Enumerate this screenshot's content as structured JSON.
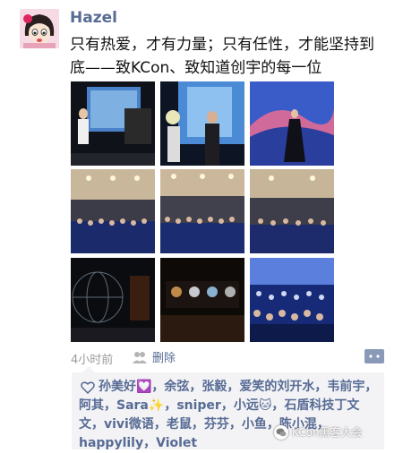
{
  "post": {
    "username": "Hazel",
    "text": "只有热爱，才有力量；只有任性，才能坚持到底——致KCon、致知道创宇的每一位",
    "timestamp": "4小时前",
    "delete_label": "删除",
    "photo_count": 9
  },
  "likes": {
    "names": "孙美好💟，余弦，张毅，爱笑的刘开水，韦前宇，阿其，Sara✨，sniper，小远🐱，石盾科技丁文文，vivi微语，老鼠，芬芬，小鱼，陈小混，happylily，Violet"
  },
  "watermark": {
    "text": "KCon黑客大会"
  },
  "colors": {
    "link_blue": "#576b95",
    "likes_bg": "#f3f3f5",
    "timestamp_gray": "#9b9b9b"
  },
  "icons": [
    "avatar-cartoon",
    "trash-icon",
    "comment-icon",
    "heart-icon",
    "wechat-icon"
  ]
}
